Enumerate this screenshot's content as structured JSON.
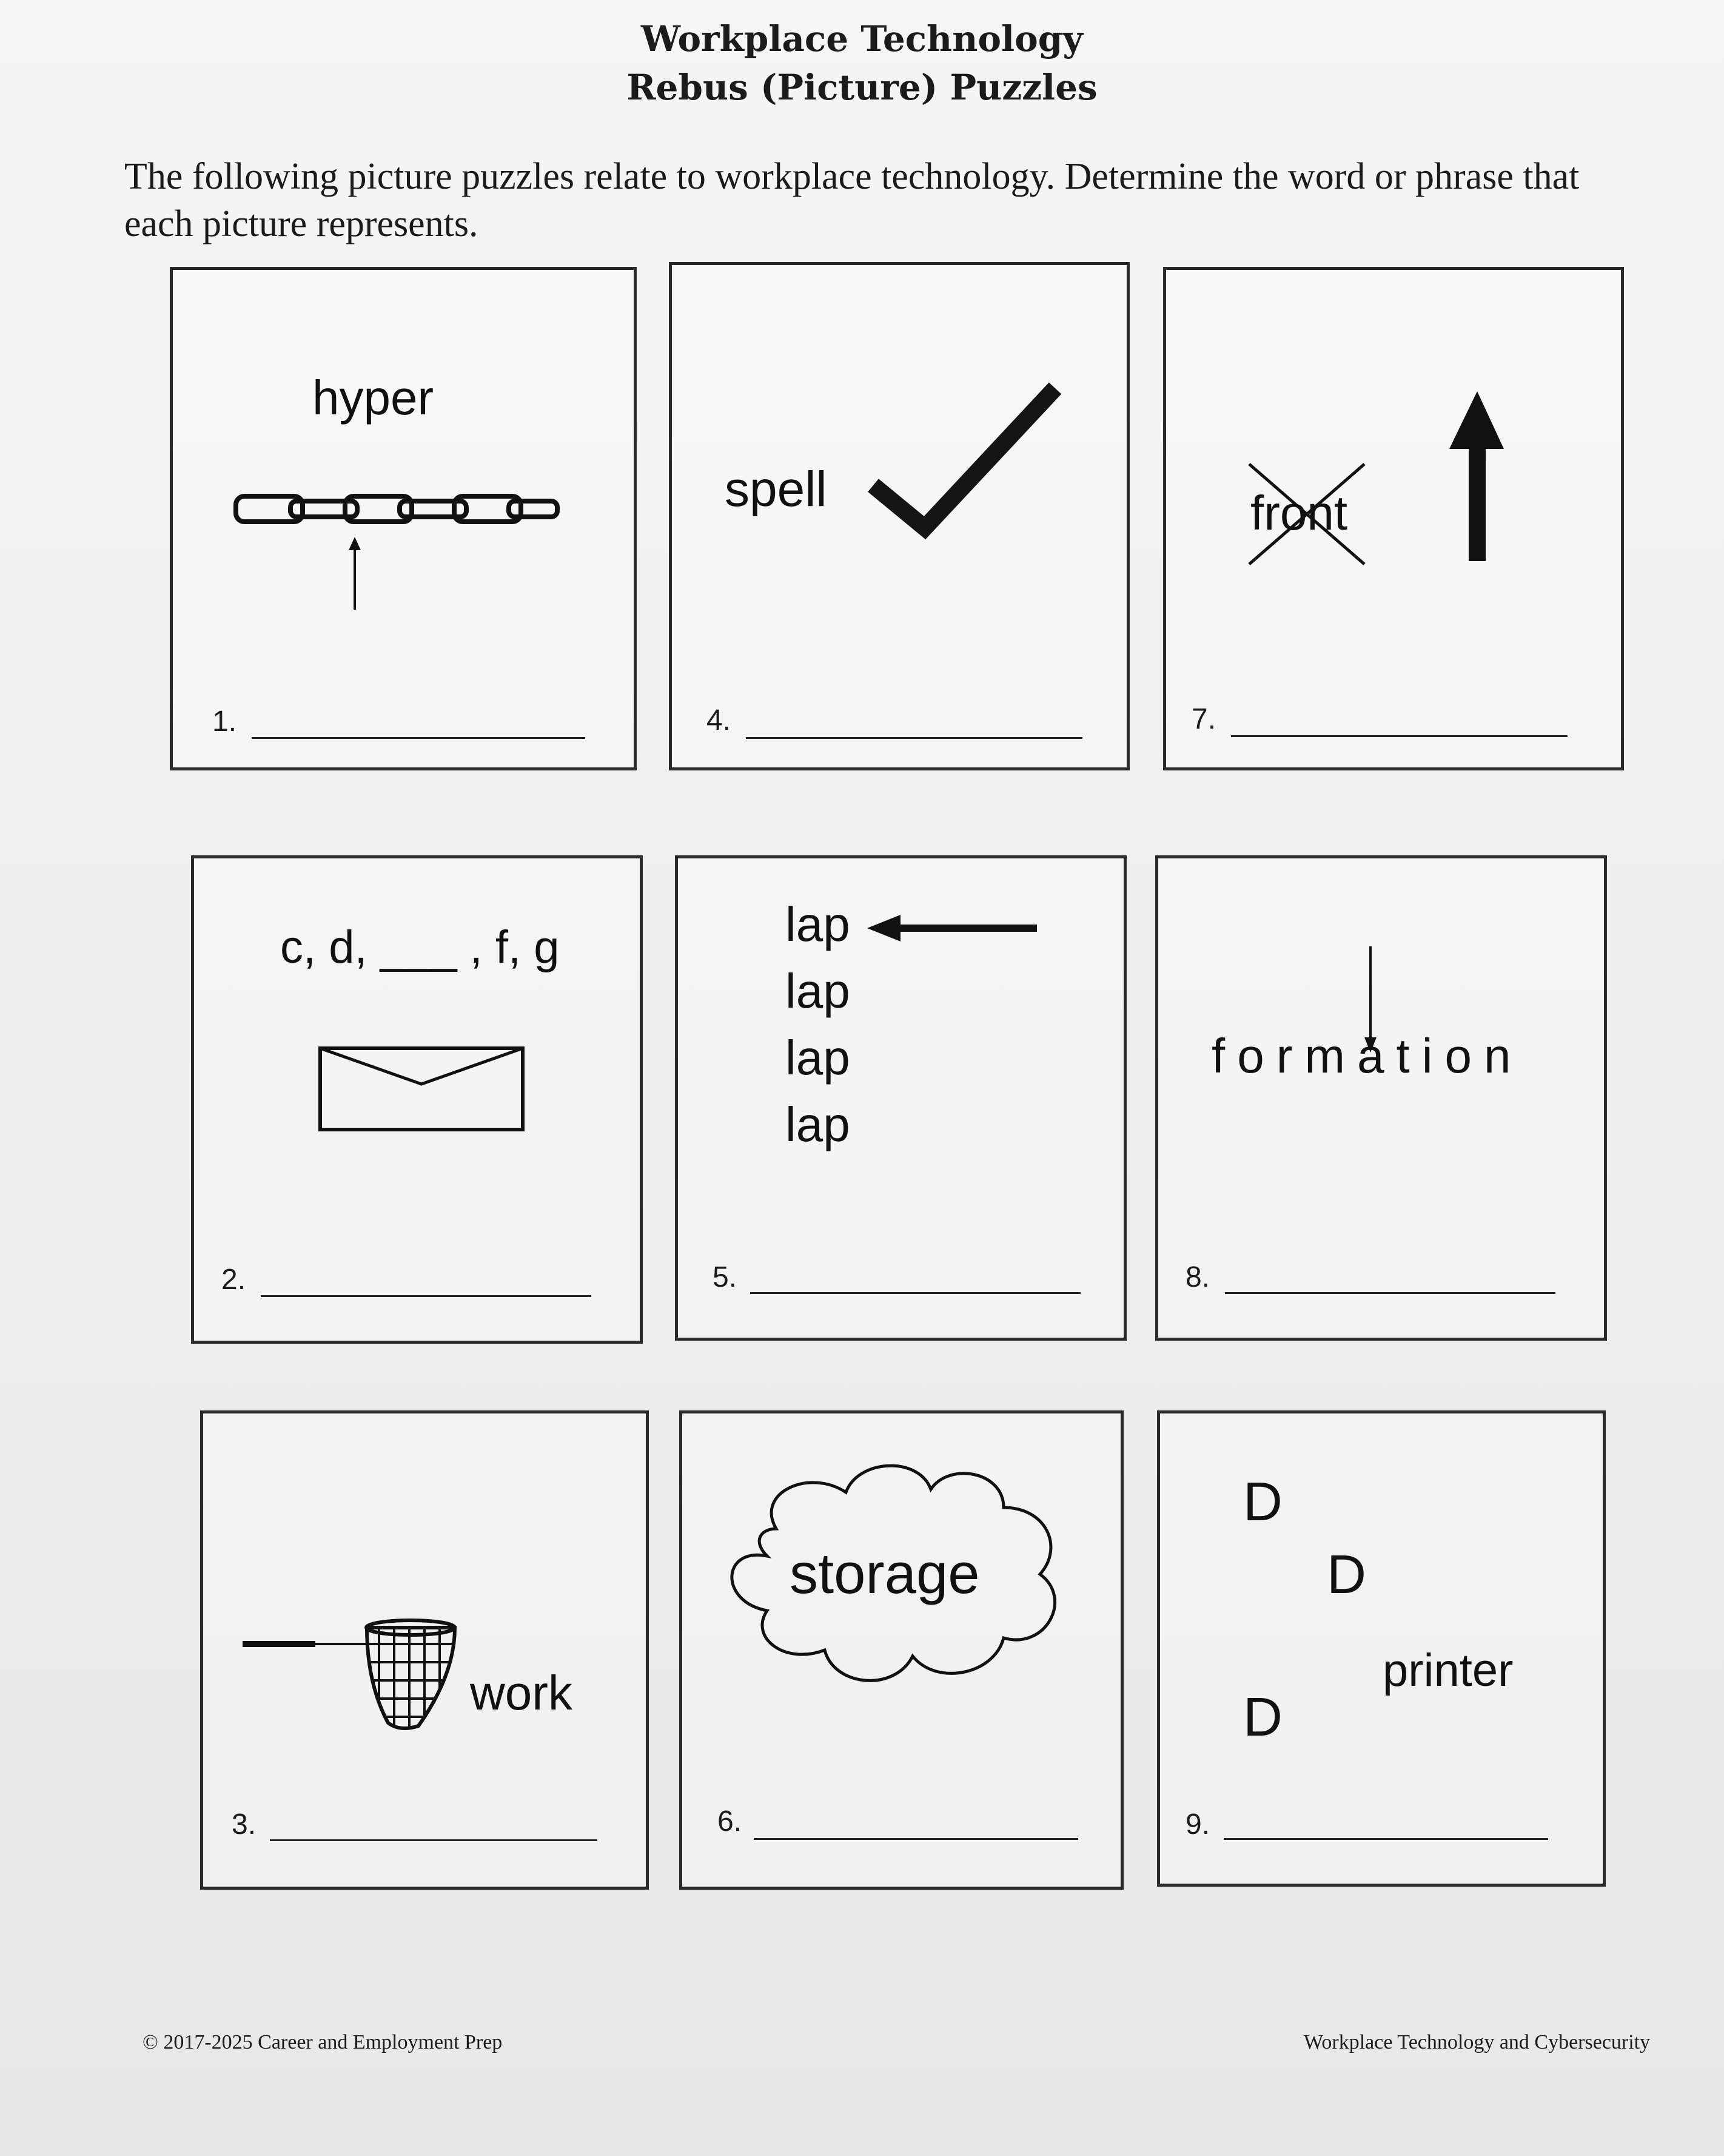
{
  "header": {
    "title_line1": "Workplace Technology",
    "title_line2": "Rebus (Picture) Puzzles"
  },
  "intro": "The following picture puzzles relate to workplace technology. Determine the word or phrase that each picture represents.",
  "puzzles": [
    {
      "number": "1.",
      "text": "hyper",
      "icons": [
        "chain-links",
        "up-arrow"
      ]
    },
    {
      "number": "2.",
      "text": "c, d, ___ , f, g",
      "icons": [
        "envelope"
      ]
    },
    {
      "number": "3.",
      "text": "work",
      "icons": [
        "net"
      ]
    },
    {
      "number": "4.",
      "text": "spell",
      "icons": [
        "check-mark"
      ]
    },
    {
      "number": "5.",
      "lines": [
        "lap",
        "lap",
        "lap",
        "lap"
      ],
      "icons": [
        "left-arrow"
      ]
    },
    {
      "number": "6.",
      "text": "storage",
      "icons": [
        "cloud"
      ]
    },
    {
      "number": "7.",
      "text": "front",
      "icons": [
        "cross-out",
        "thick-up-arrow"
      ]
    },
    {
      "number": "8.",
      "text": "formation",
      "icons": [
        "down-arrow"
      ]
    },
    {
      "number": "9.",
      "letters": [
        "D",
        "D",
        "D"
      ],
      "text": "printer",
      "icons": []
    }
  ],
  "footer": {
    "left": "© 2017-2025  Career and Employment Prep",
    "right": "Workplace Technology and Cybersecurity"
  }
}
